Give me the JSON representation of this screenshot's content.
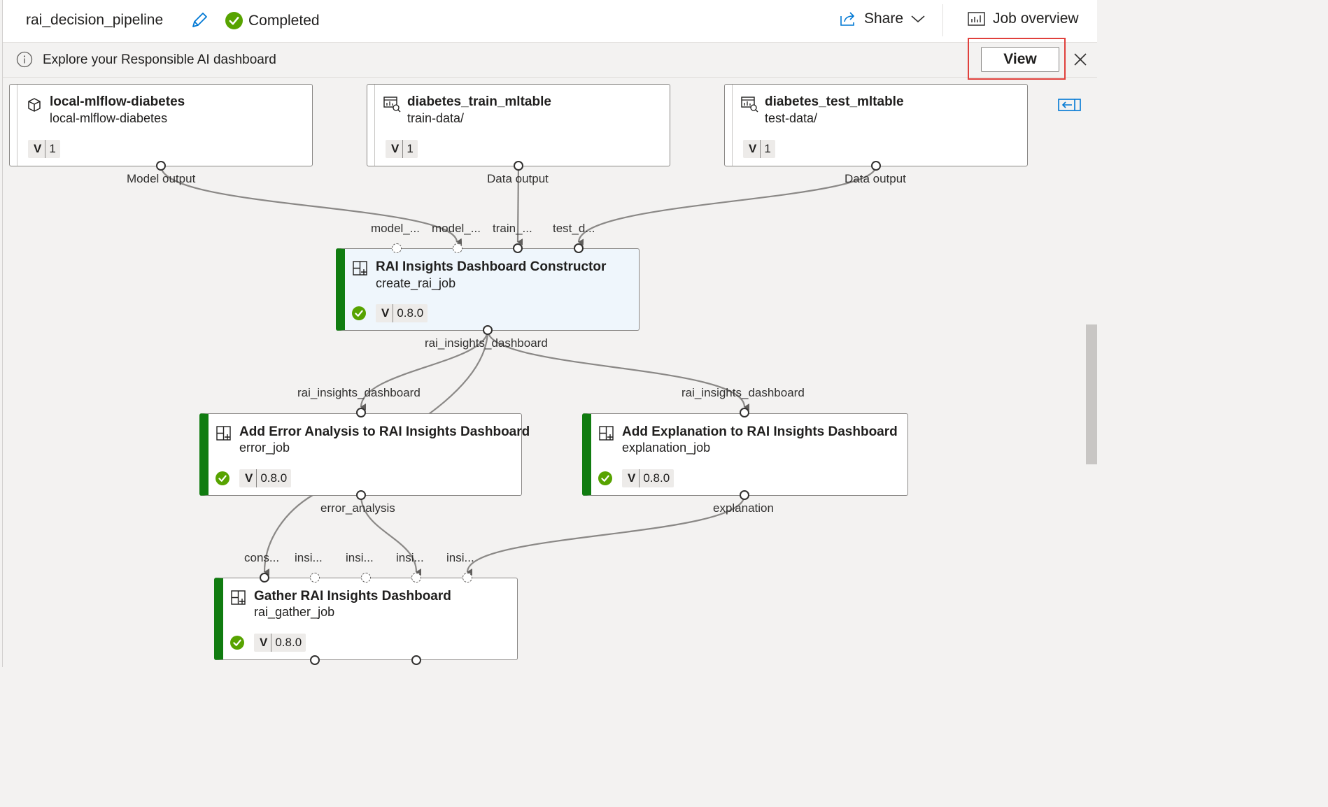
{
  "header": {
    "title": "rai_decision_pipeline",
    "status": "Completed",
    "share_label": "Share",
    "job_overview_label": "Job overview"
  },
  "banner": {
    "message": "Explore your Responsible AI dashboard",
    "view_label": "View"
  },
  "datasets": [
    {
      "title": "local-mlflow-diabetes",
      "subtitle": "local-mlflow-diabetes",
      "version_key": "V",
      "version": "1",
      "icon": "cube-icon",
      "output": "Model output"
    },
    {
      "title": "diabetes_train_mltable",
      "subtitle": "train-data/",
      "version_key": "V",
      "version": "1",
      "icon": "data-table-icon",
      "output": "Data output"
    },
    {
      "title": "diabetes_test_mltable",
      "subtitle": "test-data/",
      "version_key": "V",
      "version": "1",
      "icon": "data-table-icon",
      "output": "Data output"
    }
  ],
  "jobs": {
    "constructor": {
      "title": "RAI Insights Dashboard Constructor",
      "subtitle": "create_rai_job",
      "version_key": "V",
      "version": "0.8.0",
      "inputs": [
        "model_...",
        "model_...",
        "train_...",
        "test_d..."
      ],
      "output": "rai_insights_dashboard"
    },
    "error": {
      "title": "Add Error Analysis to RAI Insights Dashboard",
      "subtitle": "error_job",
      "version_key": "V",
      "version": "0.8.0",
      "input": "rai_insights_dashboard",
      "output": "error_analysis"
    },
    "explanation": {
      "title": "Add Explanation to RAI Insights Dashboard",
      "subtitle": "explanation_job",
      "version_key": "V",
      "version": "0.8.0",
      "input": "rai_insights_dashboard",
      "output": "explanation"
    },
    "gather": {
      "title": "Gather RAI Insights Dashboard",
      "subtitle": "rai_gather_job",
      "version_key": "V",
      "version": "0.8.0",
      "inputs": [
        "cons...",
        "insi...",
        "insi...",
        "insi...",
        "insi..."
      ]
    }
  },
  "colors": {
    "status_green": "#107c10",
    "check_green": "#57a300",
    "accent_blue": "#0078d4",
    "highlight_red": "#e0403c",
    "edge_gray": "#8a8886"
  }
}
